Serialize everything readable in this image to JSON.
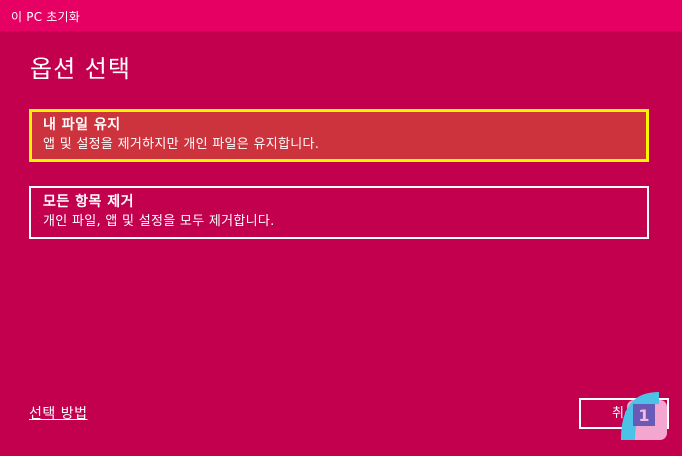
{
  "window": {
    "title": "이 PC 초기화"
  },
  "page": {
    "title": "옵션 선택"
  },
  "options": [
    {
      "title": "내 파일 유지",
      "description": "앱 및 설정을 제거하지만 개인 파일은 유지합니다.",
      "selected": true
    },
    {
      "title": "모든 항목 제거",
      "description": "개인 파일, 앱 및 설정을 모두 제거합니다.",
      "selected": false
    }
  ],
  "footer": {
    "help_link": "선택 방법",
    "cancel_label": "취소"
  },
  "colors": {
    "background": "#c2004e",
    "titlebar": "#e60064",
    "selected_fill": "#cd333d",
    "focus_border": "#fdf600"
  },
  "icons": {
    "overlay": "app-logo-icon"
  }
}
